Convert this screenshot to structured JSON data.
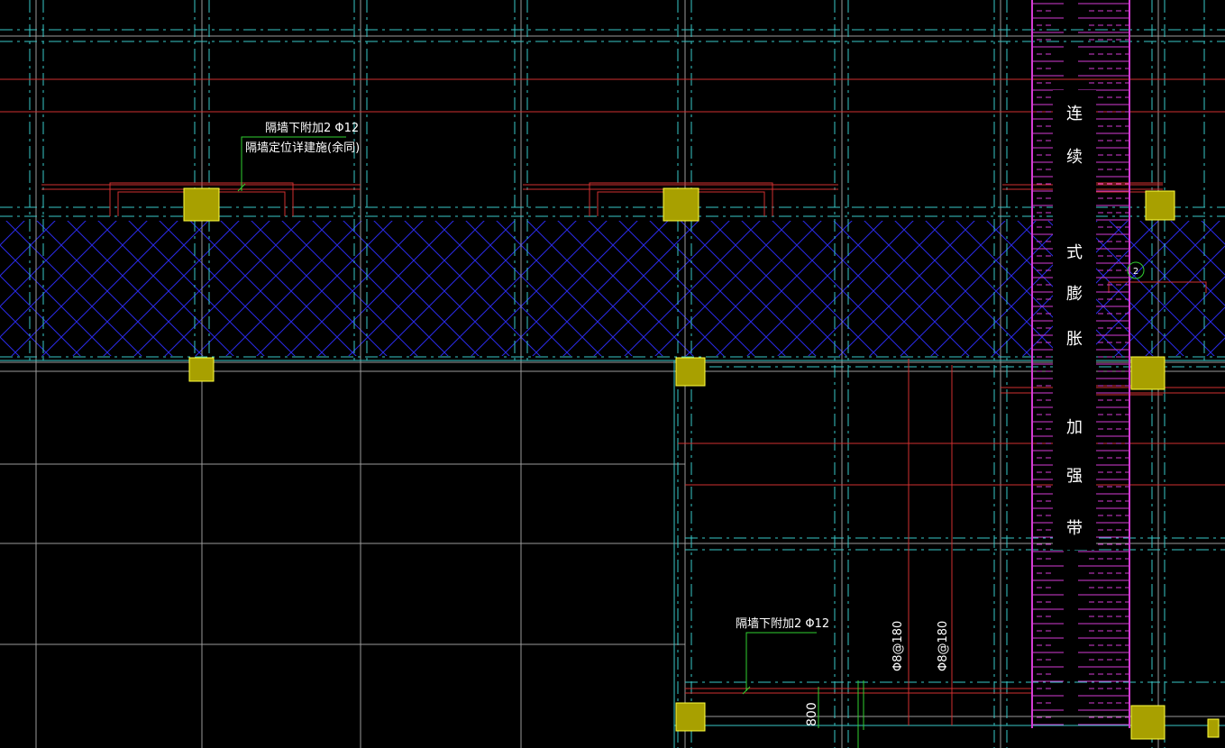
{
  "colors": {
    "background": "#000000",
    "grid_white": "#9a9a9a",
    "axis_cyan": "#38c8c8",
    "beam_red": "#d03030",
    "hatch_blue": "#2a2ae8",
    "band_magenta": "#d53cd5",
    "column_fill": "#a8a000",
    "column_edge": "#ffff40",
    "leader_green": "#30d030"
  },
  "annotations": {
    "note_top_line1": "隔墙下附加2 Φ12",
    "note_top_line2": "隔墙定位详建施(余同)",
    "note_bottom": "隔墙下附加2 Φ12",
    "rebar_label_1": "Φ8@180",
    "rebar_label_2": "Φ8@180",
    "dimension_800": "800",
    "section_mark": "2"
  },
  "expansion_band": {
    "chars": [
      "连",
      "续",
      "式",
      "膨",
      "胀",
      "加",
      "强",
      "带"
    ]
  },
  "column_count": 9
}
